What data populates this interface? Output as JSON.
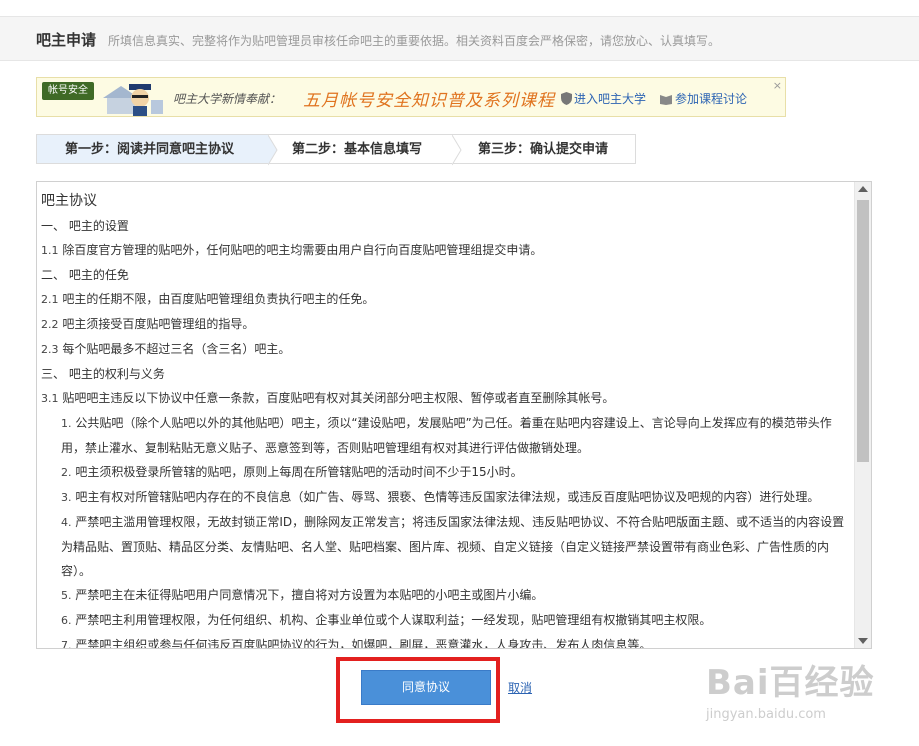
{
  "header": {
    "title": "吧主申请",
    "subtitle": "所填信息真实、完整将作为贴吧管理员审核任命吧主的重要依据。相关资料百度会严格保密，请您放心、认真填写。"
  },
  "banner": {
    "badge": "帐号安全",
    "prefix": "吧主大学新情奉献：",
    "course": "五月帐号安全知识普及系列课程",
    "link_university": "进入吧主大学",
    "link_discussion": "参加课程讨论",
    "close": "×"
  },
  "steps": [
    {
      "label": "第一步：阅读并同意吧主协议",
      "active": true
    },
    {
      "label": "第二步：基本信息填写",
      "active": false
    },
    {
      "label": "第三步：确认提交申请",
      "active": false
    }
  ],
  "agreement": {
    "title": "吧主协议",
    "lines": [
      {
        "num": "",
        "text": "一、 吧主的设置",
        "indent": false
      },
      {
        "num": "1.1",
        "text": " 除百度官方管理的贴吧外，任何贴吧的吧主均需要由用户自行向百度贴吧管理组提交申请。",
        "indent": false
      },
      {
        "num": "",
        "text": "二、 吧主的任免",
        "indent": false
      },
      {
        "num": "2.1",
        "text": " 吧主的任期不限，由百度贴吧管理组负责执行吧主的任免。",
        "indent": false
      },
      {
        "num": "2.2",
        "text": " 吧主须接受百度贴吧管理组的指导。",
        "indent": false
      },
      {
        "num": "2.3",
        "text": " 每个贴吧最多不超过三名（含三名）吧主。",
        "indent": false
      },
      {
        "num": "",
        "text": "三、 吧主的权利与义务",
        "indent": false
      },
      {
        "num": "3.1",
        "text": " 贴吧吧主违反以下协议中任意一条款，百度贴吧有权对其关闭部分吧主权限、暂停或者直至删除其帐号。",
        "indent": false
      },
      {
        "num": "1.",
        "text": " 公共贴吧（除个人贴吧以外的其他贴吧）吧主，须以“建设贴吧，发展贴吧”为己任。着重在贴吧内容建设上、言论导向上发挥应有的模范带头作",
        "indent": true
      },
      {
        "num": "",
        "text": "用，禁止灌水、复制粘贴无意义贴子、恶意签到等，否则贴吧管理组有权对其进行评估做撤销处理。",
        "indent": true
      },
      {
        "num": "2.",
        "text": " 吧主须积极登录所管辖的贴吧，原则上每周在所管辖贴吧的活动时间不少于15小时。",
        "indent": true
      },
      {
        "num": "3.",
        "text": " 吧主有权对所管辖贴吧内存在的不良信息（如广告、辱骂、猥亵、色情等违反国家法律法规，或违反百度贴吧协议及吧规的内容）进行处理。",
        "indent": true
      },
      {
        "num": "4.",
        "text": " 严禁吧主滥用管理权限，无故封锁正常ID，删除网友正常发言；将违反国家法律法规、违反贴吧协议、不符合贴吧版面主题、或不适当的内容设置",
        "indent": true
      },
      {
        "num": "",
        "text": "为精品贴、置顶贴、精品区分类、友情贴吧、名人堂、贴吧档案、图片库、视频、自定义链接（自定义链接严禁设置带有商业色彩、广告性质的内",
        "indent": true
      },
      {
        "num": "",
        "text": "容）。",
        "indent": true
      },
      {
        "num": "5.",
        "text": " 严禁吧主在未征得贴吧用户同意情况下，擅自将对方设置为本贴吧的小吧主或图片小编。",
        "indent": true
      },
      {
        "num": "6.",
        "text": " 严禁吧主利用管理权限，为任何组织、机构、企事业单位或个人谋取利益；一经发现，贴吧管理组有权撤销其吧主权限。",
        "indent": true
      },
      {
        "num": "7.",
        "text": " 严禁吧主组织或参与任何违反百度贴吧协议的行为，如爆吧，刷屏，恶意灌水，人身攻击、发布人肉信息等。",
        "indent": true
      }
    ]
  },
  "actions": {
    "agree": "同意协议",
    "cancel": "取消"
  },
  "watermark": {
    "main": "Bai百经验",
    "sub": "jingyan.baidu.com"
  }
}
